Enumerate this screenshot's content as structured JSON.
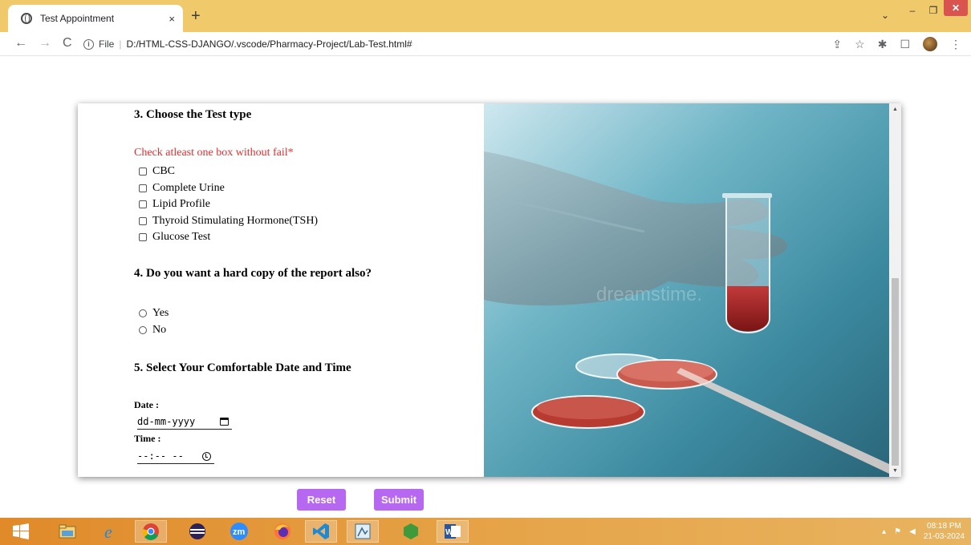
{
  "browser": {
    "tab_title": "Test Appointment",
    "tab_close": "×",
    "new_tab": "+",
    "url_scheme_label": "File",
    "url_separator": "|",
    "url": "D:/HTML-CSS-DJANGO/.vscode/Pharmacy-Project/Lab-Test.html#",
    "back": "←",
    "forward": "→",
    "reload": "C",
    "info": "i",
    "share_icon": "⇪",
    "star_icon": "☆",
    "extensions_icon": "✱",
    "sidepanel_icon": "☐",
    "menu_icon": "⋮",
    "tab_search": "⌄",
    "minimize": "–",
    "maximize": "❐",
    "close": "✕"
  },
  "form": {
    "q3_heading": "3. Choose the Test type",
    "warning": "Check atleast one box without fail*",
    "tests": [
      {
        "label": "CBC",
        "checked": false
      },
      {
        "label": "Complete Urine",
        "checked": false
      },
      {
        "label": "Lipid Profile",
        "checked": false
      },
      {
        "label": "Thyroid Stimulating Hormone(TSH)",
        "checked": false
      },
      {
        "label": "Glucose Test",
        "checked": false
      }
    ],
    "q4_heading": "4. Do you want a hard copy of the report also?",
    "hardcopy_options": [
      {
        "label": "Yes",
        "selected": false
      },
      {
        "label": "No",
        "selected": false
      }
    ],
    "q5_heading": "5. Select Your Comfortable Date and Time",
    "date_label": "Date :",
    "date_placeholder": "dd-mm-yyyy",
    "time_label": "Time :",
    "time_placeholder": "--:-- --"
  },
  "image": {
    "watermark": "dreamstime."
  },
  "buttons": {
    "reset": "Reset",
    "submit": "Submit"
  },
  "taskbar": {
    "time": "08:18 PM",
    "date": "21-03-2024"
  },
  "colors": {
    "tabbar": "#f0c96b",
    "warning": "#e52e2e",
    "button": "#b668f0",
    "taskbar": "#e08a2a"
  }
}
